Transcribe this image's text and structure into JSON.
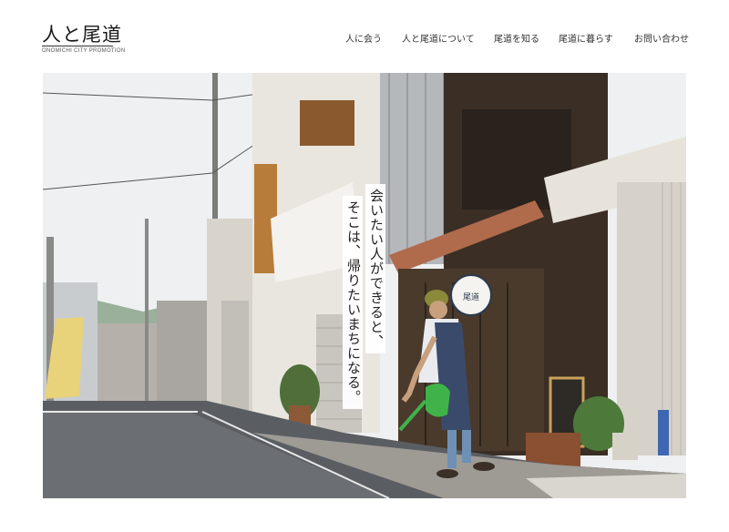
{
  "header": {
    "logo_text": "人と尾道",
    "logo_subtext": "ONOMICHI CITY PROMOTION",
    "nav": [
      {
        "label": "人に会う"
      },
      {
        "label": "人と尾道について"
      },
      {
        "label": "尾道を知る"
      },
      {
        "label": "尾道に暮らす"
      },
      {
        "label": "お問い合わせ"
      }
    ]
  },
  "hero": {
    "copy_line1": "会いたい人ができると、",
    "copy_line2": "そこは、帰りたいまちになる。",
    "sign_text": "尾道",
    "colors": {
      "sky": "#eef0f1",
      "road": "#5a5e63",
      "watering_can": "#3fb34a",
      "apron": "#3a4a6a"
    }
  }
}
